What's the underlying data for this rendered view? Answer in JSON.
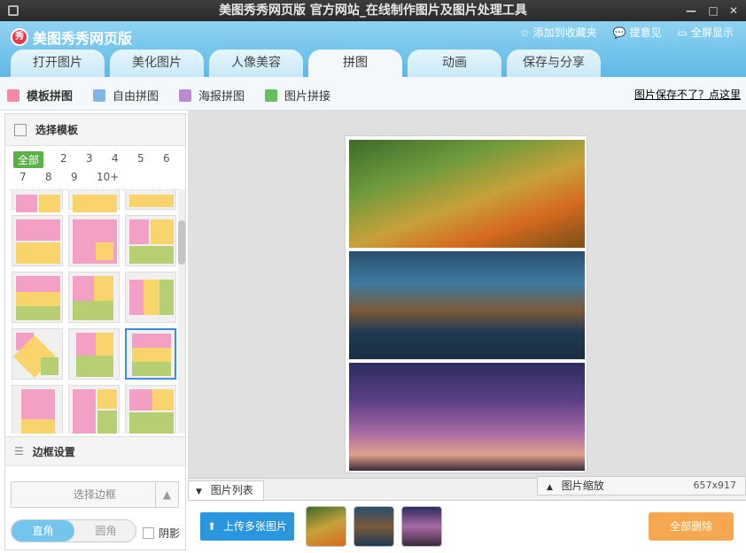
{
  "window": {
    "title": "美图秀秀网页版 官方网站_在线制作图片及图片处理工具"
  },
  "header": {
    "logo_text": "美图秀秀网页版",
    "links": [
      "添加到收藏夹",
      "提意见",
      "全屏显示"
    ]
  },
  "tabs": [
    "打开图片",
    "美化图片",
    "人像美容",
    "拼图",
    "动画",
    "保存与分享"
  ],
  "active_tab": "拼图",
  "subbar": {
    "items": [
      "模板拼图",
      "自由拼图",
      "海报拼图",
      "图片拼接"
    ],
    "help_link": "图片保存不了？点这里"
  },
  "template_panel": {
    "title": "选择模板",
    "numbers": [
      "全部",
      "2",
      "3",
      "4",
      "5",
      "6",
      "7",
      "8",
      "9",
      "10+"
    ],
    "selected_number": "全部"
  },
  "border_panel": {
    "title": "边框设置",
    "select_label": "选择边框",
    "toggle_on": "直角",
    "toggle_off": "圆角",
    "shadow_label": "阴影"
  },
  "bottom": {
    "list_tab": "图片列表",
    "zoom_tab": "图片缩放",
    "dimensions": "657x917",
    "upload_label": "上传多张图片",
    "delete_all_label": "全部删除"
  },
  "colors": {
    "accent_blue": "#2a96dd",
    "delete_orange": "#f6a850",
    "active_num": "#5bb04a"
  }
}
